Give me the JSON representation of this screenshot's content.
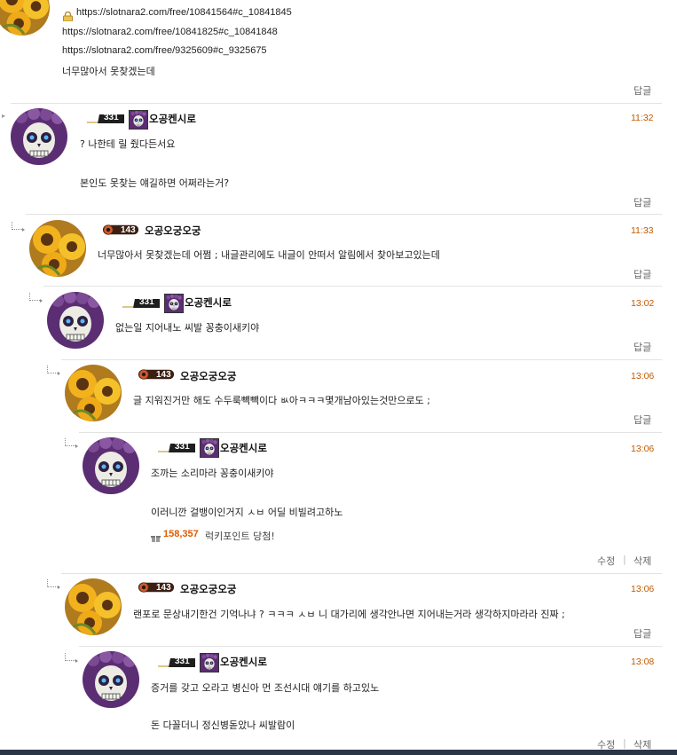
{
  "top_comment": {
    "lock_icon": "lock-icon",
    "links": [
      "https://slotnara2.com/free/10841564#c_10841845",
      "https://slotnara2.com/free/10841825#c_10841848",
      "https://slotnara2.com/free/9325609#c_9325675"
    ],
    "text": "너무많아서 못찾겠는데",
    "reply_label": "답글"
  },
  "comments": [
    {
      "nick": "오공켄시로",
      "level": "331",
      "time": "11:32",
      "lines": [
        "? 나한테 릴 줬다든서요",
        "본인도 못찾는 얘길하면 어쩌라는거?"
      ],
      "reply_label": "답글"
    },
    {
      "nick": "오공오궁오궁",
      "level": "143",
      "time": "11:33",
      "lines": [
        "너무많아서 못찾겠는데 어쩜 ; 내글관리에도 내글이 안떠서 알림에서 찾아보고있는데"
      ],
      "reply_label": "답글"
    },
    {
      "nick": "오공켄시로",
      "level": "331",
      "time": "13:02",
      "lines": [
        "없는일 지어내노 씨발 꽁충이새키야"
      ],
      "reply_label": "답글"
    },
    {
      "nick": "오공오궁오궁",
      "level": "143",
      "time": "13:06",
      "lines": [
        "글 지워진거만 해도 수두룩빽빽이다 ㅄ아ㅋㅋㅋ몇개남아있는것만으로도 ;"
      ],
      "reply_label": "답글"
    },
    {
      "nick": "오공켄시로",
      "level": "331",
      "time": "13:06",
      "lines": [
        "조까는 소리마라 꽁충이새키야",
        "이러니깐 걸뱅이인거지 ㅅㅂ 어딜 비빌려고하노"
      ],
      "points_value": "158,357",
      "points_text": "럭키포인트 당첨!",
      "edit_label": "수정",
      "delete_label": "삭제"
    },
    {
      "nick": "오공오궁오궁",
      "level": "143",
      "time": "13:06",
      "lines": [
        "랜포로 문상내기한건 기억나냐 ? ㅋㅋㅋ ㅅㅂ 니 대가리에 생각안나면 지어내는거라 생각하지마라라 진짜 ;"
      ],
      "reply_label": "답글"
    },
    {
      "nick": "오공켄시로",
      "level": "331",
      "time": "13:08",
      "lines": [
        "증거를 갖고 오라고 병신아 먼 조선시대 얘기를 하고있노",
        "돈 다꼴더니 정신병돋았나 씨발람이"
      ],
      "edit_label": "수정",
      "delete_label": "삭제"
    }
  ],
  "colors": {
    "time": "#c05a00",
    "points": "#e05a00",
    "separator": "#e3e3e3"
  }
}
